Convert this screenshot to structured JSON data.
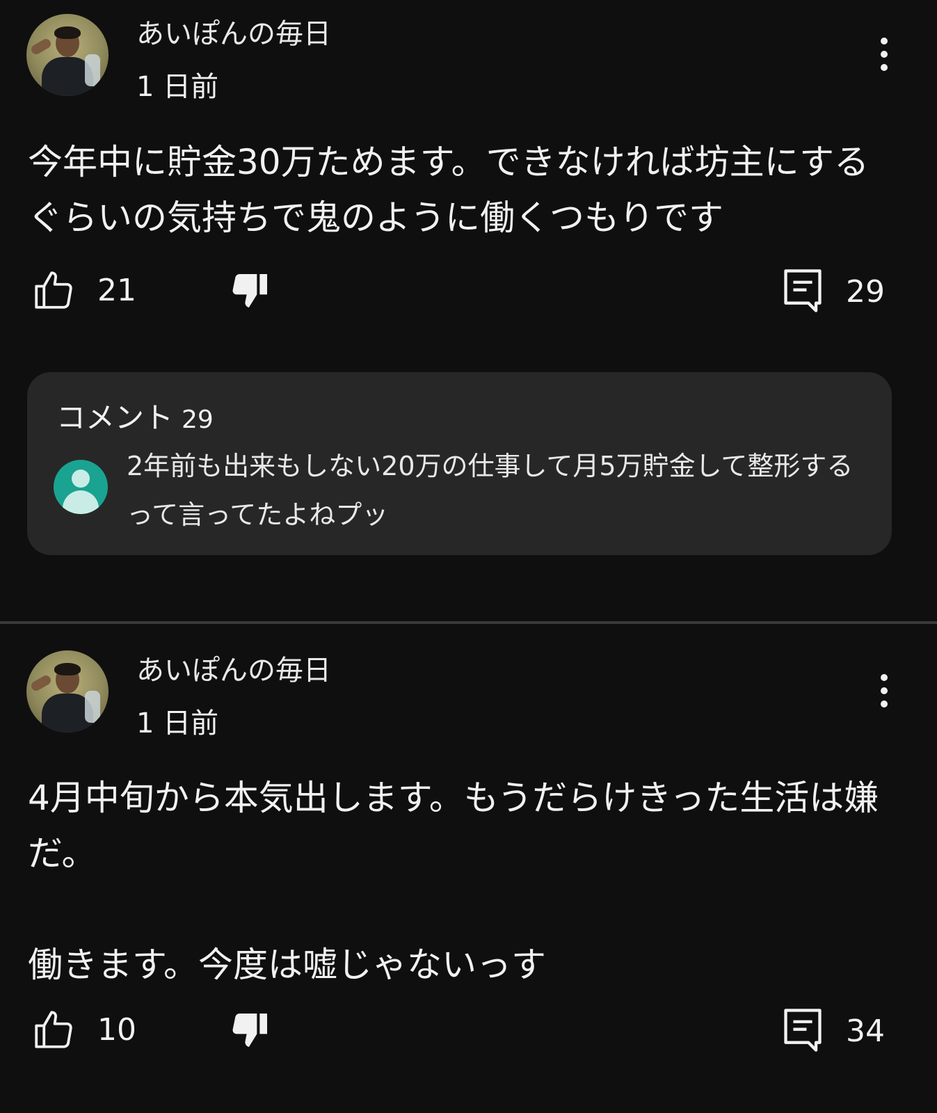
{
  "comments": [
    {
      "author": "あいぽんの毎日",
      "time": "1 日前",
      "text": "今年中に貯金30万ためます。できなければ坊主にするぐらいの気持ちで鬼のように働くつもりです",
      "likes": "21",
      "replies_count": "29",
      "reply_preview": {
        "header_label": "コメント",
        "header_count": "29",
        "text": "2年前も出来もしない20万の仕事して月5万貯金して整形するって言ってたよねプッ"
      }
    },
    {
      "author": "あいぽんの毎日",
      "time": "1 日前",
      "text": "4月中旬から本気出します。もうだらけきった生活は嫌だ。\n\n働きます。今度は嘘じゃないっす",
      "likes": "10",
      "replies_count": "34"
    }
  ],
  "icons": {
    "like": "thumbs-up-outline",
    "dislike": "thumbs-down-filled",
    "reply": "comment-reply",
    "more": "vertical-ellipsis"
  }
}
